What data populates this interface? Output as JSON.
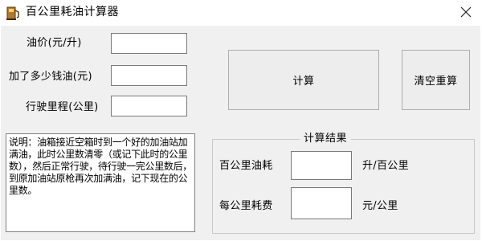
{
  "window": {
    "title": "百公里耗油计算器"
  },
  "inputs": {
    "fuel_price_label": "油价(元/升)",
    "fuel_price_value": "",
    "money_added_label": "加了多少钱油(元)",
    "money_added_value": "",
    "distance_label": "行驶里程(公里)",
    "distance_value": ""
  },
  "buttons": {
    "calculate": "计算",
    "clear": "清空重算"
  },
  "description": {
    "text": "说明：油箱接近空箱时到一个好的加油站加满油，此时公里数清零（或记下此时的公里数），然后正常行驶，待行驶一完公里数后，到原加油站原枪再次加满油，记下现在的公里数。"
  },
  "results": {
    "group_title": "计算结果",
    "consumption_label": "百公里油耗",
    "consumption_value": "",
    "consumption_unit": "升/百公里",
    "cost_label": "每公里耗费",
    "cost_value": "",
    "cost_unit": "元/公里"
  }
}
